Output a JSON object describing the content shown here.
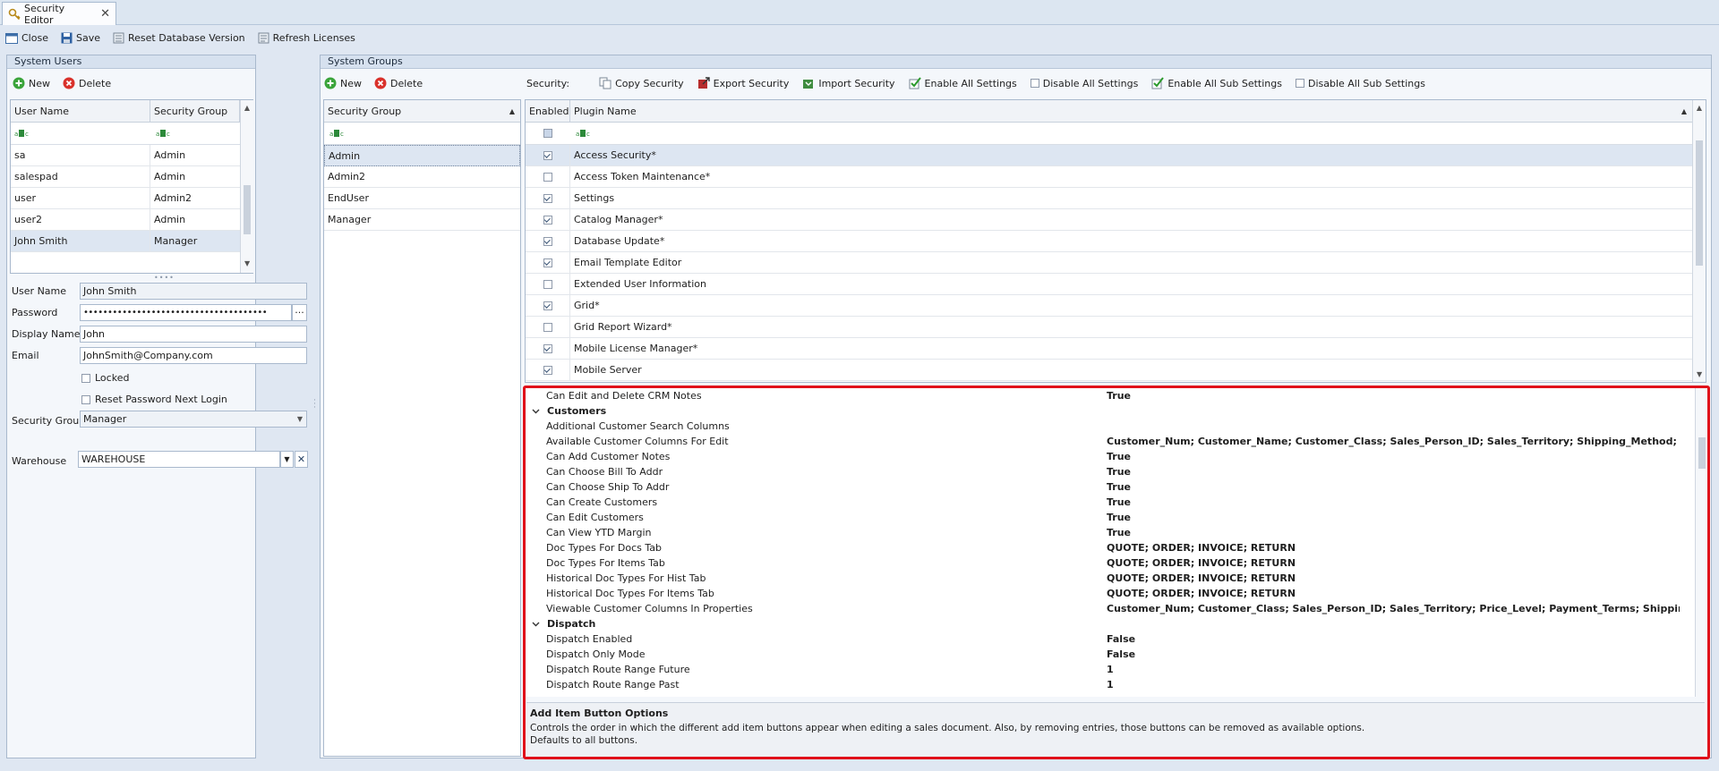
{
  "window": {
    "tab_label": "Security Editor",
    "close_tab": "✕"
  },
  "toolbar": {
    "close_label": "Close",
    "save_label": "Save",
    "reset_db_label": "Reset Database Version",
    "refresh_label": "Refresh Licenses"
  },
  "system_users": {
    "title": "System Users",
    "new_label": "New",
    "delete_label": "Delete",
    "columns": [
      "User Name",
      "Security Group"
    ],
    "rows": [
      {
        "user": "sa",
        "group": "Admin"
      },
      {
        "user": "salespad",
        "group": "Admin"
      },
      {
        "user": "user",
        "group": "Admin2"
      },
      {
        "user": "user2",
        "group": "Admin"
      },
      {
        "user": "John Smith",
        "group": "Manager"
      }
    ],
    "form": {
      "user_name_label": "User Name",
      "user_name": "John Smith",
      "password_label": "Password",
      "password": "••••••••••••••••••••••••••••••••••••••",
      "display_name_label": "Display Name",
      "display_name": "John",
      "email_label": "Email",
      "email": "JohnSmith@Company.com",
      "locked_label": "Locked",
      "reset_pw_label": "Reset Password Next Login",
      "security_group_label": "Security Group",
      "security_group": "Manager",
      "warehouse_label": "Warehouse",
      "warehouse": "WAREHOUSE"
    }
  },
  "system_groups": {
    "title": "System Groups",
    "new_label": "New",
    "delete_label": "Delete",
    "column": "Security Group",
    "rows": [
      "Admin",
      "Admin2",
      "EndUser",
      "Manager"
    ]
  },
  "security": {
    "label": "Security:",
    "copy_label": "Copy Security",
    "export_label": "Export Security",
    "import_label": "Import Security",
    "enable_all_label": "Enable All Settings",
    "disable_all_label": "Disable All Settings",
    "enable_sub_label": "Enable All Sub Settings",
    "disable_sub_label": "Disable All Sub Settings",
    "columns": [
      "Enabled",
      "Plugin Name"
    ],
    "plugins": [
      {
        "name": "Access Security*",
        "enabled": true
      },
      {
        "name": "Access Token Maintenance*",
        "enabled": false
      },
      {
        "name": "Settings",
        "enabled": true
      },
      {
        "name": "Catalog Manager*",
        "enabled": true
      },
      {
        "name": "Database Update*",
        "enabled": true
      },
      {
        "name": "Email Template Editor",
        "enabled": true
      },
      {
        "name": "Extended User Information",
        "enabled": false
      },
      {
        "name": "Grid*",
        "enabled": true
      },
      {
        "name": "Grid Report Wizard*",
        "enabled": false
      },
      {
        "name": "Mobile License Manager*",
        "enabled": true
      },
      {
        "name": "Mobile Server",
        "enabled": true
      }
    ]
  },
  "properties": {
    "top_row": {
      "name": "Can Edit and Delete CRM Notes",
      "value": "True"
    },
    "customers": {
      "title": "Customers",
      "items": [
        {
          "name": "Additional Customer Search Columns",
          "value": ""
        },
        {
          "name": "Available Customer Columns For Edit",
          "value": "Customer_Num; Customer_Name; Customer_Class; Sales_Person_ID; Sales_Territory; Shipping_Method; Payme"
        },
        {
          "name": "Can Add Customer Notes",
          "value": "True"
        },
        {
          "name": "Can Choose Bill To Addr",
          "value": "True"
        },
        {
          "name": "Can Choose Ship To Addr",
          "value": "True"
        },
        {
          "name": "Can Create Customers",
          "value": "True"
        },
        {
          "name": "Can Edit Customers",
          "value": "True"
        },
        {
          "name": "Can View YTD Margin",
          "value": "True"
        },
        {
          "name": "Doc Types For Docs Tab",
          "value": "QUOTE; ORDER; INVOICE; RETURN"
        },
        {
          "name": "Doc Types For Items Tab",
          "value": "QUOTE; ORDER; INVOICE; RETURN"
        },
        {
          "name": "Historical Doc Types For Hist Tab",
          "value": "QUOTE; ORDER; INVOICE; RETURN"
        },
        {
          "name": "Historical Doc Types For Items Tab",
          "value": "QUOTE; ORDER; INVOICE; RETURN"
        },
        {
          "name": "Viewable Customer Columns In Properties",
          "value": "Customer_Num; Customer_Class; Sales_Person_ID; Sales_Territory; Price_Level; Payment_Terms; Shipping_Me"
        }
      ]
    },
    "dispatch": {
      "title": "Dispatch",
      "items": [
        {
          "name": "Dispatch Enabled",
          "value": "False"
        },
        {
          "name": "Dispatch Only Mode",
          "value": "False"
        },
        {
          "name": "Dispatch Route Range Future",
          "value": "1"
        },
        {
          "name": "Dispatch Route Range Past",
          "value": "1"
        }
      ]
    },
    "description": {
      "title": "Add Item Button Options",
      "line1": "Controls the order in which the different add item buttons appear when editing a sales document. Also, by removing entries, those buttons can be removed as available options.",
      "line2": "Defaults to all buttons."
    }
  },
  "colors": {
    "highlight_border": "#e0101a",
    "accent": "#1f5fa8"
  }
}
